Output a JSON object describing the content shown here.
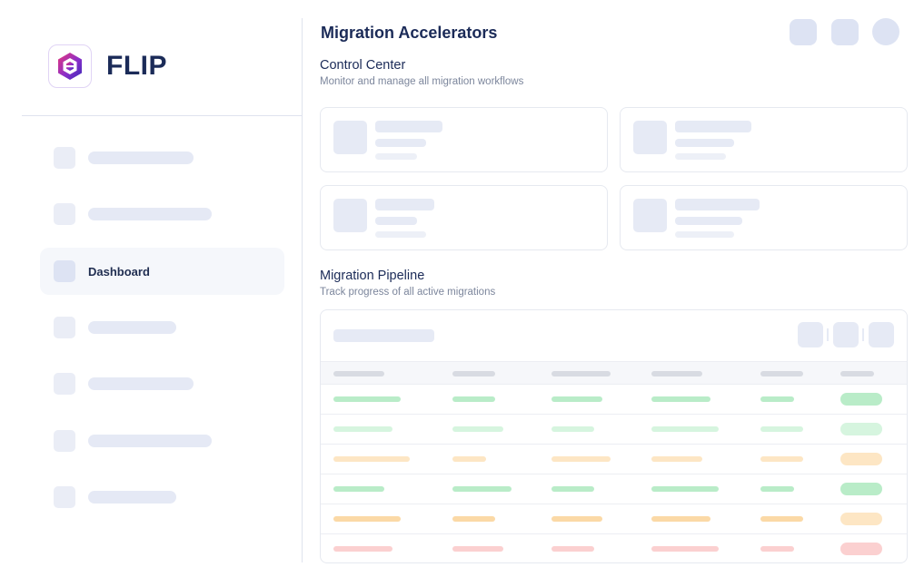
{
  "app": {
    "brand": "FLIP"
  },
  "sidebar": {
    "items": [
      {
        "label": "",
        "placeholder": true
      },
      {
        "label": "",
        "placeholder": true
      },
      {
        "label": "Dashboard",
        "active": true
      },
      {
        "label": "",
        "placeholder": true
      },
      {
        "label": "",
        "placeholder": true
      },
      {
        "label": "",
        "placeholder": true
      },
      {
        "label": "",
        "placeholder": true
      }
    ]
  },
  "header": {
    "title": "Migration Accelerators"
  },
  "control_center": {
    "title": "Control Center",
    "subtitle": "Monitor and manage all migration workflows"
  },
  "pipeline": {
    "title": "Migration Pipeline",
    "subtitle": "Track progress of all active migrations",
    "row_statuses": [
      "success",
      "success-light",
      "warning-light",
      "success",
      "warning",
      "error"
    ]
  },
  "colors": {
    "brand_navy": "#1b2b58",
    "logo_purple": "#6a2bd0",
    "logo_pink": "#d6307a",
    "skeleton": "#e6eaf5",
    "success": "#b9ecc8",
    "success_light": "#d6f5df",
    "warning": "#fbd9a6",
    "warning_light": "#fde6c4",
    "error": "#fbd0d0"
  }
}
